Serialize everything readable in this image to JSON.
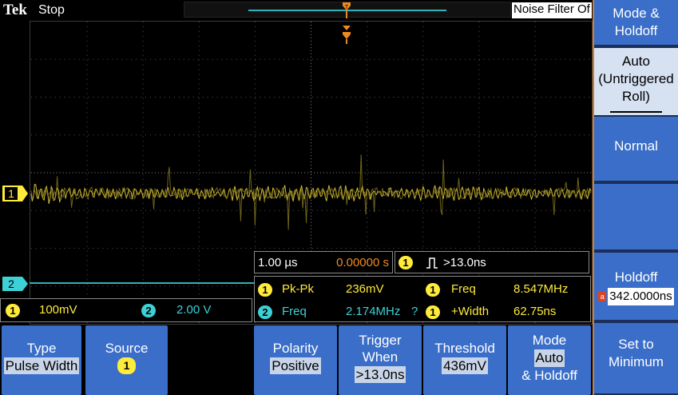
{
  "header": {
    "logo": "Tek",
    "run_state": "Stop",
    "noise_filter": "Noise Filter Of"
  },
  "channels": {
    "ch1_marker": "1",
    "ch2_marker": "2",
    "ch1_scale": "100mV",
    "ch2_scale": "2.00 V",
    "ch1_color": "#ffeb3b",
    "ch2_color": "#3dd0d6"
  },
  "timebase": {
    "scale": "1.00 µs",
    "trigger_position": "0.00000 s"
  },
  "trigger_info": {
    "source_badge": "1",
    "condition": ">13.0ns"
  },
  "measurements": [
    {
      "badge": "1",
      "name": "Pk-Pk",
      "value": "236mV",
      "flag": ""
    },
    {
      "badge": "1",
      "name": "Freq",
      "value": "8.547MHz",
      "flag": ""
    },
    {
      "badge": "2",
      "name": "Freq",
      "value": "2.174MHz",
      "flag": "?"
    },
    {
      "badge": "1",
      "name": "+Width",
      "value": "62.75ns",
      "flag": ""
    }
  ],
  "bottom_menu": {
    "type_label": "Type",
    "type_value": "Pulse Width",
    "source_label": "Source",
    "source_value": "1",
    "polarity_label": "Polarity",
    "polarity_value": "Positive",
    "trigwhen_label1": "Trigger",
    "trigwhen_label2": "When",
    "trigwhen_value": ">13.0ns",
    "threshold_label": "Threshold",
    "threshold_value": "436mV",
    "mode_label": "Mode",
    "mode_value1": "Auto",
    "mode_value2": "& Holdoff"
  },
  "side_menu": {
    "title1": "Mode &",
    "title2": "Holdoff",
    "auto1": "Auto",
    "auto2": "(Untriggered",
    "auto3": "Roll)",
    "normal": "Normal",
    "holdoff_label": "Holdoff",
    "holdoff_adjust": "a",
    "holdoff_value": "342.0000ns",
    "setmin1": "Set to",
    "setmin2": "Minimum"
  }
}
